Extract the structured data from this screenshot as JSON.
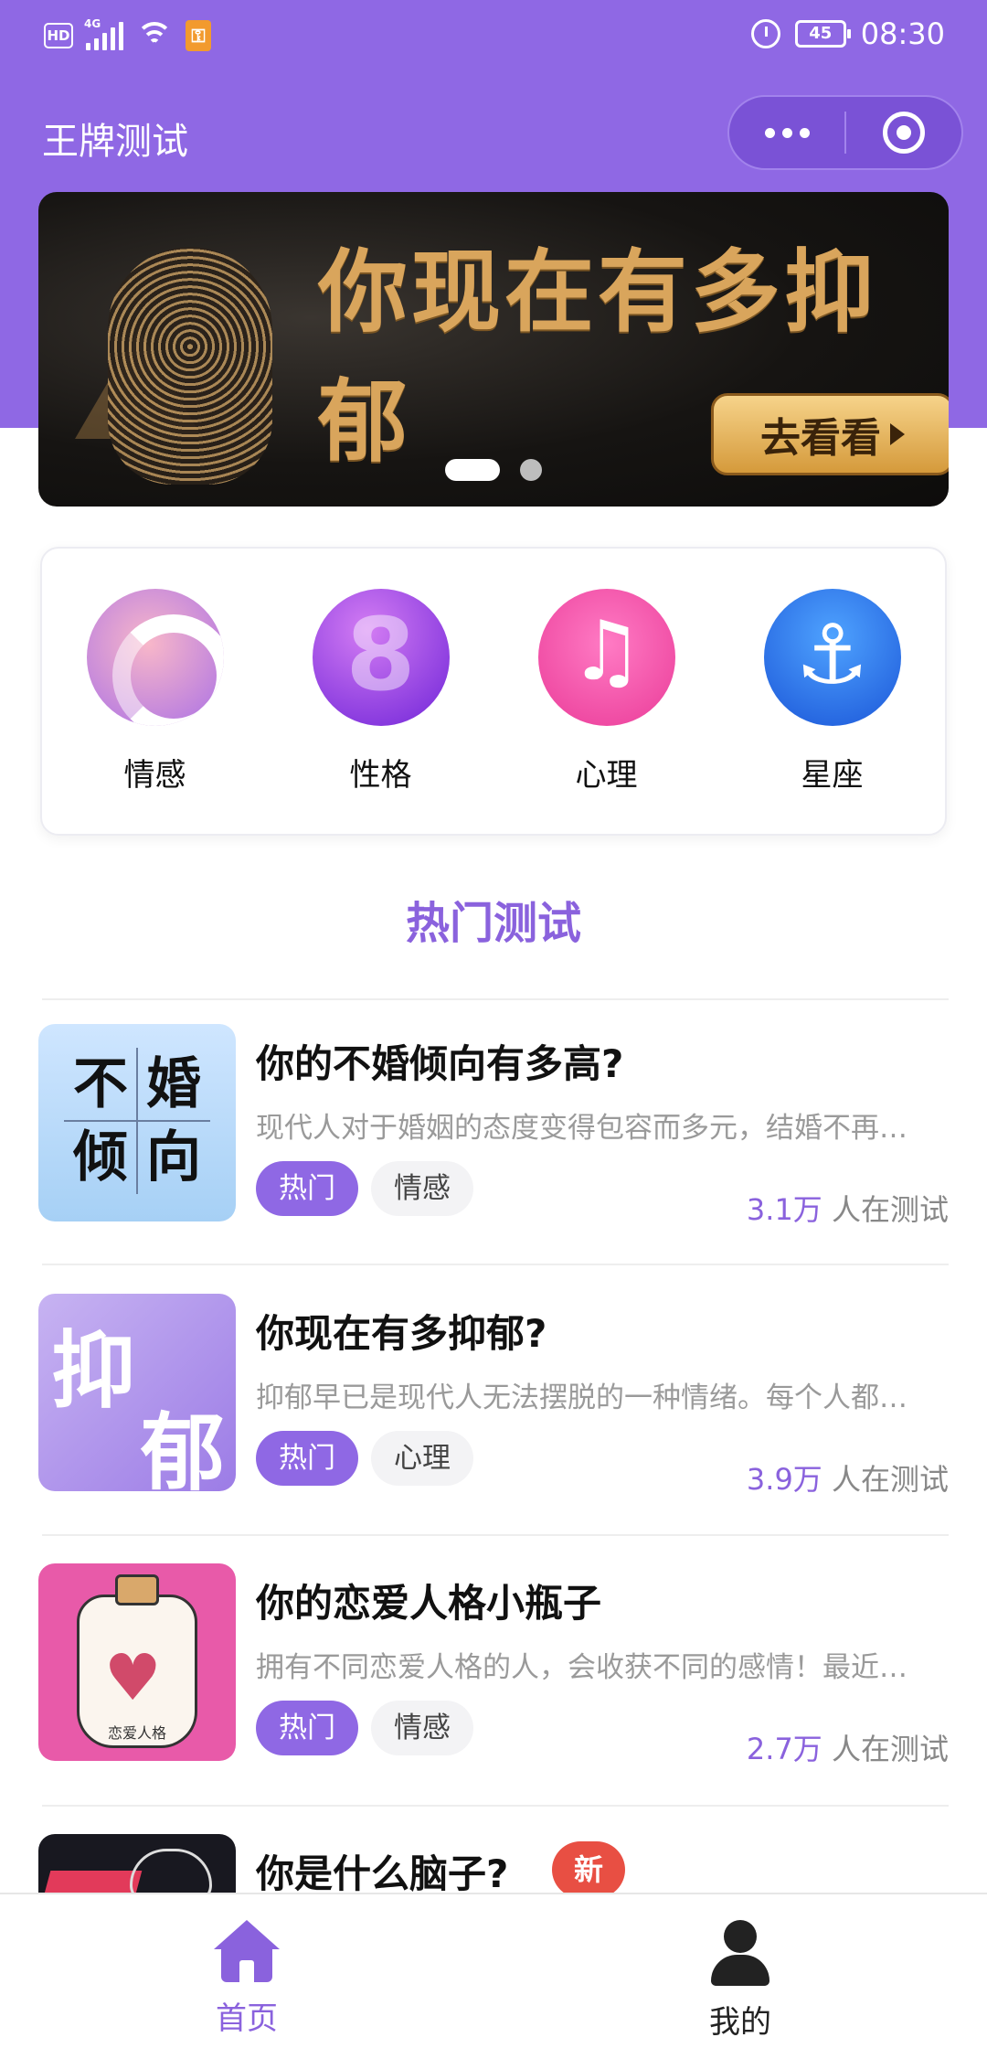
{
  "status_bar": {
    "hd": "HD",
    "network": "4G",
    "battery": "45",
    "time": "08:30"
  },
  "header": {
    "title": "王牌测试"
  },
  "banner": {
    "title": "你现在有多抑郁",
    "button_label": "去看看",
    "active_slide": 1,
    "slide_count": 2
  },
  "categories": [
    {
      "label": "情感",
      "icon": "rings-icon"
    },
    {
      "label": "性格",
      "icon": "figure-eight-icon"
    },
    {
      "label": "心理",
      "icon": "music-note-icon"
    },
    {
      "label": "星座",
      "icon": "anchor-icon"
    }
  ],
  "section_title": "热门测试",
  "tests": [
    {
      "title": "你的不婚倾向有多高?",
      "desc": "现代人对于婚姻的态度变得包容而多元，结婚不再…",
      "tags": [
        "热门",
        "情感"
      ],
      "count_num": "3.1万",
      "count_suffix": " 人在测试",
      "thumb_text": [
        "不",
        "婚",
        "倾",
        "向"
      ]
    },
    {
      "title": "你现在有多抑郁?",
      "desc": "抑郁早已是现代人无法摆脱的一种情绪。每个人都…",
      "tags": [
        "热门",
        "心理"
      ],
      "count_num": "3.9万",
      "count_suffix": " 人在测试",
      "thumb_text": [
        "抑",
        "郁"
      ]
    },
    {
      "title": "你的恋爱人格小瓶子",
      "desc": "拥有不同恋爱人格的人，会收获不同的感情！最近…",
      "tags": [
        "热门",
        "情感"
      ],
      "count_num": "2.7万",
      "count_suffix": " 人在测试",
      "thumb_text": [
        "恋爱人格"
      ]
    },
    {
      "title": "你是什么脑子?",
      "badge": "新"
    }
  ],
  "bottom_nav": [
    {
      "label": "首页",
      "icon": "home-icon",
      "active": true
    },
    {
      "label": "我的",
      "icon": "user-icon",
      "active": false
    }
  ],
  "colors": {
    "brand": "#8f68e4",
    "accent_text": "#8a62dd",
    "new_badge": "#e84f43"
  }
}
